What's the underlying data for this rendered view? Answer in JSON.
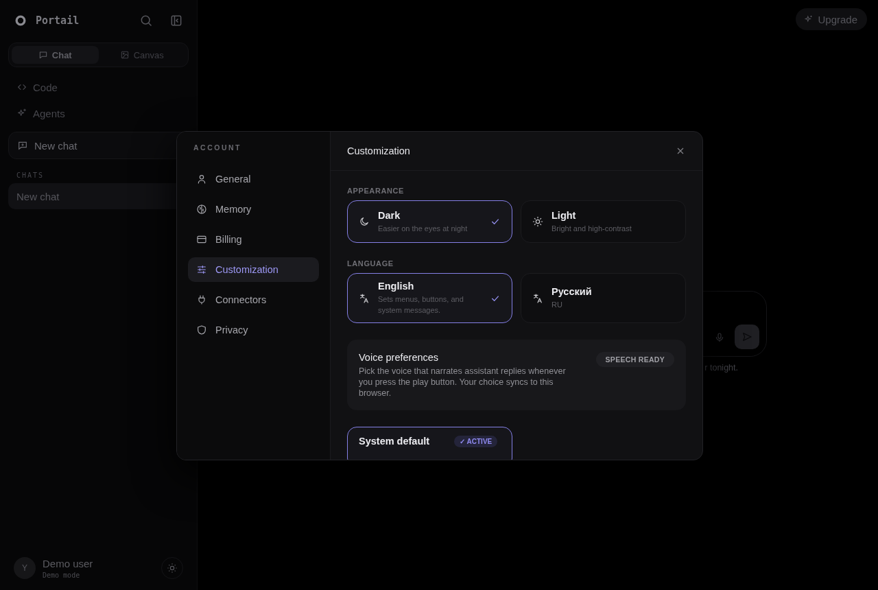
{
  "app": {
    "name": "Portail"
  },
  "mode_tabs": [
    {
      "label": "Chat",
      "selected": true
    },
    {
      "label": "Canvas",
      "selected": false
    }
  ],
  "nav": [
    {
      "label": "Code"
    },
    {
      "label": "Agents"
    }
  ],
  "new_chat": "New chat",
  "chats": {
    "heading": "CHATS",
    "items": [
      {
        "label": "New chat",
        "selected": true
      }
    ]
  },
  "user": {
    "avatar": "Y",
    "name": "Demo user",
    "status": "Demo mode"
  },
  "upgrade": "Upgrade",
  "composer_hint": "r tonight.",
  "dialog": {
    "section": "ACCOUNT",
    "nav": [
      {
        "label": "General",
        "selected": false
      },
      {
        "label": "Memory",
        "selected": false
      },
      {
        "label": "Billing",
        "selected": false
      },
      {
        "label": "Customization",
        "selected": true
      },
      {
        "label": "Connectors",
        "selected": false
      },
      {
        "label": "Privacy",
        "selected": false
      }
    ],
    "title": "Customization",
    "groups": [
      {
        "heading": "APPEARANCE",
        "options": [
          {
            "title": "Dark",
            "description": "Easier on the eyes at night",
            "selected": true
          },
          {
            "title": "Light",
            "description": "Bright and high-contrast",
            "selected": false
          }
        ]
      },
      {
        "heading": "LANGUAGE",
        "options": [
          {
            "title": "English",
            "description": "Sets menus, buttons, and system messages.",
            "selected": true
          },
          {
            "title": "Русский",
            "description": "RU",
            "selected": false
          }
        ]
      }
    ],
    "voice": {
      "title": "Voice preferences",
      "description": "Pick the voice that narrates assistant replies whenever you press the play button. Your choice syncs to this browser.",
      "badge": "SPEECH READY"
    },
    "voice_options": [
      {
        "title": "System default",
        "badge": "✓ ACTIVE",
        "selected": true
      }
    ]
  }
}
